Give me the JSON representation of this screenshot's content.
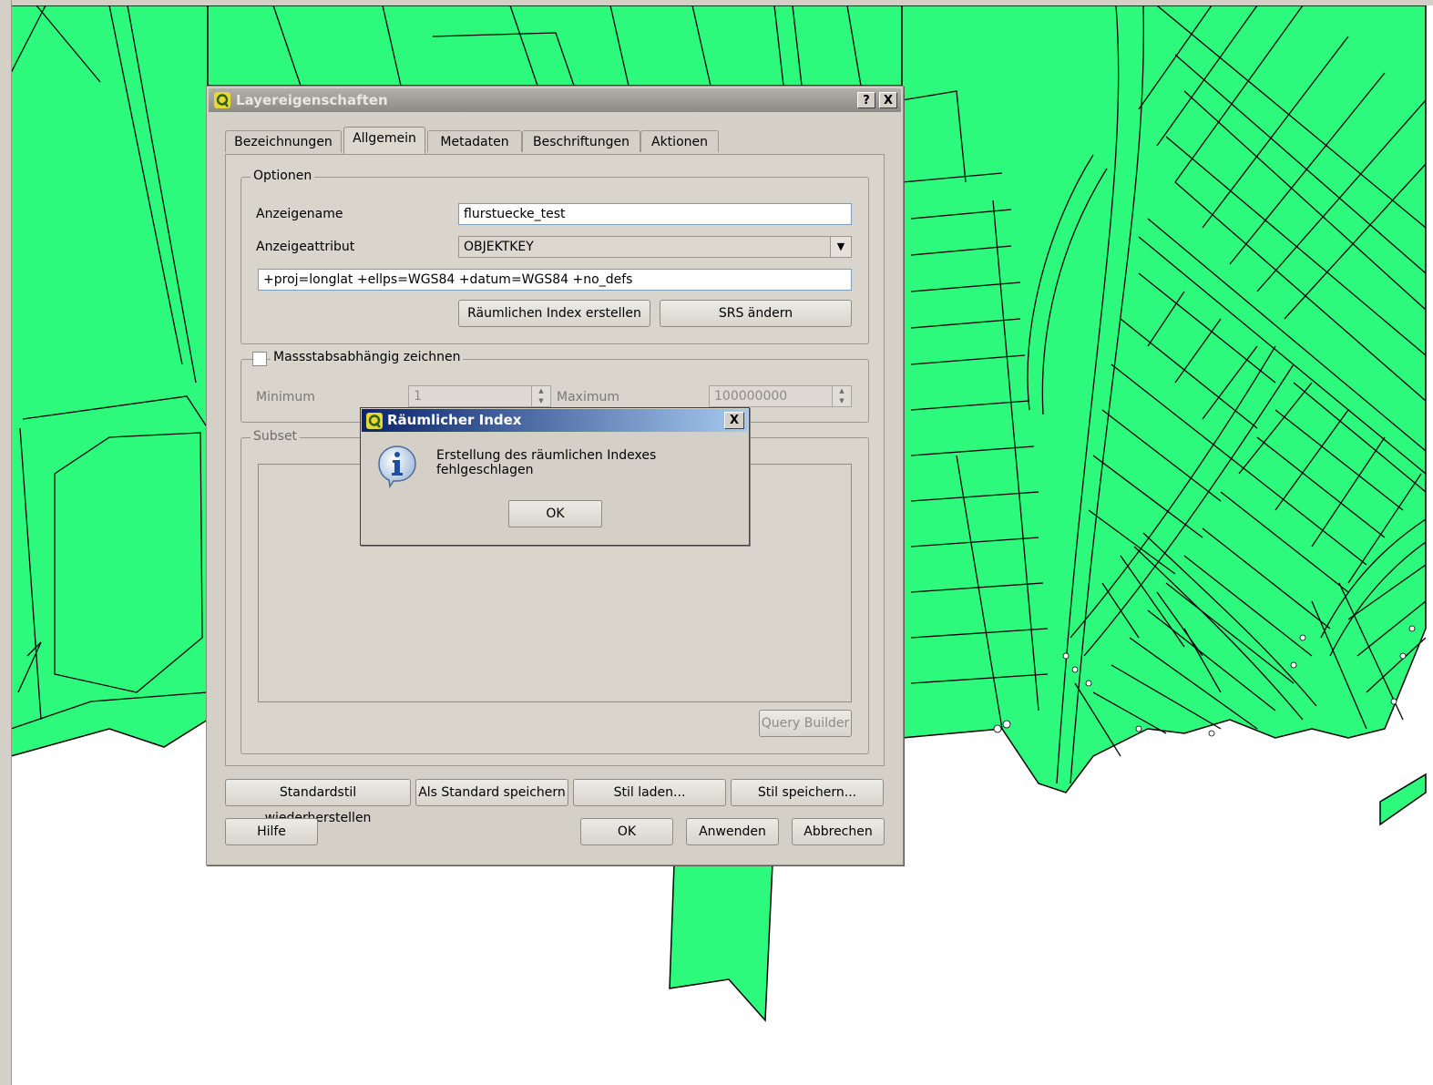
{
  "dialog": {
    "title": "Layereigenschaften",
    "help_button": "?",
    "close_button": "X",
    "tabs": [
      "Bezeichnungen",
      "Allgemein",
      "Metadaten",
      "Beschriftungen",
      "Aktionen"
    ],
    "active_tab": "Allgemein",
    "options": {
      "group_title": "Optionen",
      "display_name_label": "Anzeigename",
      "display_name_value": "flurstuecke_test",
      "display_field_label": "Anzeigeattribut",
      "display_field_value": "OBJEKTKEY",
      "srs_value": "+proj=longlat +ellps=WGS84 +datum=WGS84 +no_defs",
      "create_index_button": "Räumlichen Index erstellen",
      "change_srs_button": "SRS ändern"
    },
    "scale": {
      "checkbox_label": "Massstabsabhängig zeichnen",
      "checked": false,
      "minimum_label": "Minimum",
      "minimum_value": "1",
      "maximum_label": "Maximum",
      "maximum_value": "100000000"
    },
    "subset": {
      "group_title": "Subset",
      "query_builder_button": "Query Builder"
    },
    "style_buttons": {
      "restore_default": "Standardstil wiederherstellen",
      "save_as_default": "Als Standard speichern",
      "load_style": "Stil laden...",
      "save_style": "Stil speichern..."
    },
    "footer": {
      "help": "Hilfe",
      "ok": "OK",
      "apply": "Anwenden",
      "cancel": "Abbrechen"
    }
  },
  "message_box": {
    "title": "Räumlicher Index",
    "close_button": "X",
    "icon": "info-icon",
    "message": "Erstellung des räumlichen Indexes fehlgeschlagen",
    "ok_button": "OK"
  },
  "colors": {
    "parcel_fill": "#2dfa7d",
    "parcel_stroke": "#000000",
    "dialog_bg": "#d4d0c8",
    "msgbox_title_start": "#0a246a",
    "msgbox_title_end": "#a6caf0"
  }
}
